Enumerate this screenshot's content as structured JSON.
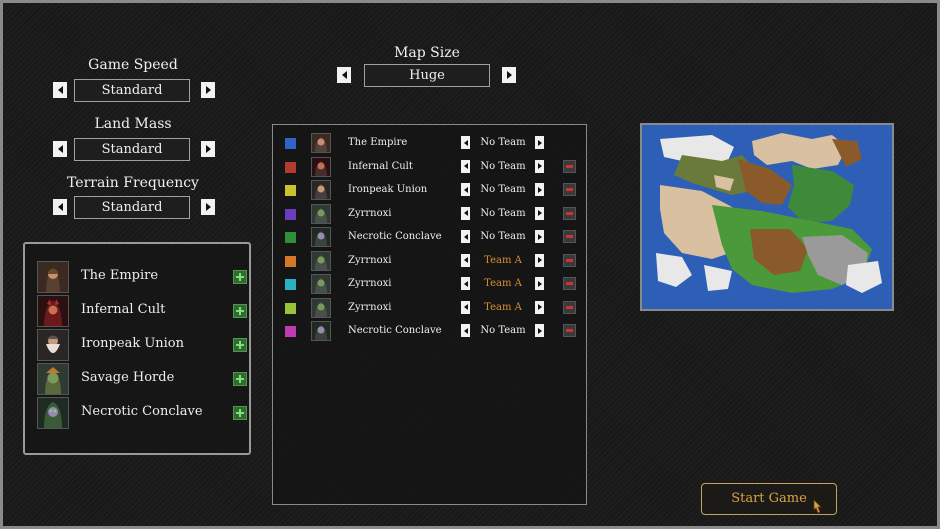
{
  "settings": {
    "game_speed": {
      "label": "Game Speed",
      "value": "Standard"
    },
    "land_mass": {
      "label": "Land Mass",
      "value": "Standard"
    },
    "terrain_frequency": {
      "label": "Terrain Frequency",
      "value": "Standard"
    },
    "map_size": {
      "label": "Map Size",
      "value": "Huge"
    }
  },
  "civilizations": [
    {
      "name": "The Empire",
      "portrait": "empire-portrait-icon"
    },
    {
      "name": "Infernal Cult",
      "portrait": "infernal-portrait-icon"
    },
    {
      "name": "Ironpeak Union",
      "portrait": "dwarf-portrait-icon"
    },
    {
      "name": "Savage Horde",
      "portrait": "orc-portrait-icon"
    },
    {
      "name": "Necrotic Conclave",
      "portrait": "undead-portrait-icon"
    }
  ],
  "players": [
    {
      "color": "#2f63c8",
      "name": "The Empire",
      "team": "No Team",
      "removable": false
    },
    {
      "color": "#b23a32",
      "name": "Infernal Cult",
      "team": "No Team",
      "removable": true
    },
    {
      "color": "#c9c22a",
      "name": "Ironpeak Union",
      "team": "No Team",
      "removable": true
    },
    {
      "color": "#6a3cc0",
      "name": "Zyrrnoxi",
      "team": "No Team",
      "removable": true
    },
    {
      "color": "#2f8e3a",
      "name": "Necrotic Conclave",
      "team": "No Team",
      "removable": true
    },
    {
      "color": "#d6782a",
      "name": "Zyrrnoxi",
      "team": "Team A",
      "removable": true
    },
    {
      "color": "#2ab0c0",
      "name": "Zyrrnoxi",
      "team": "Team A",
      "removable": true
    },
    {
      "color": "#9ac23a",
      "name": "Zyrrnoxi",
      "team": "Team A",
      "removable": true
    },
    {
      "color": "#c03ab0",
      "name": "Necrotic Conclave",
      "team": "No Team",
      "removable": true
    }
  ],
  "start_button": {
    "label": "Start Game"
  },
  "colors": {
    "accent": "#d9a14a",
    "team_a": "#d8912e",
    "add_green": "#2f6b2f",
    "remove_red": "#cc3333",
    "ocean": "#2c5fb5"
  }
}
